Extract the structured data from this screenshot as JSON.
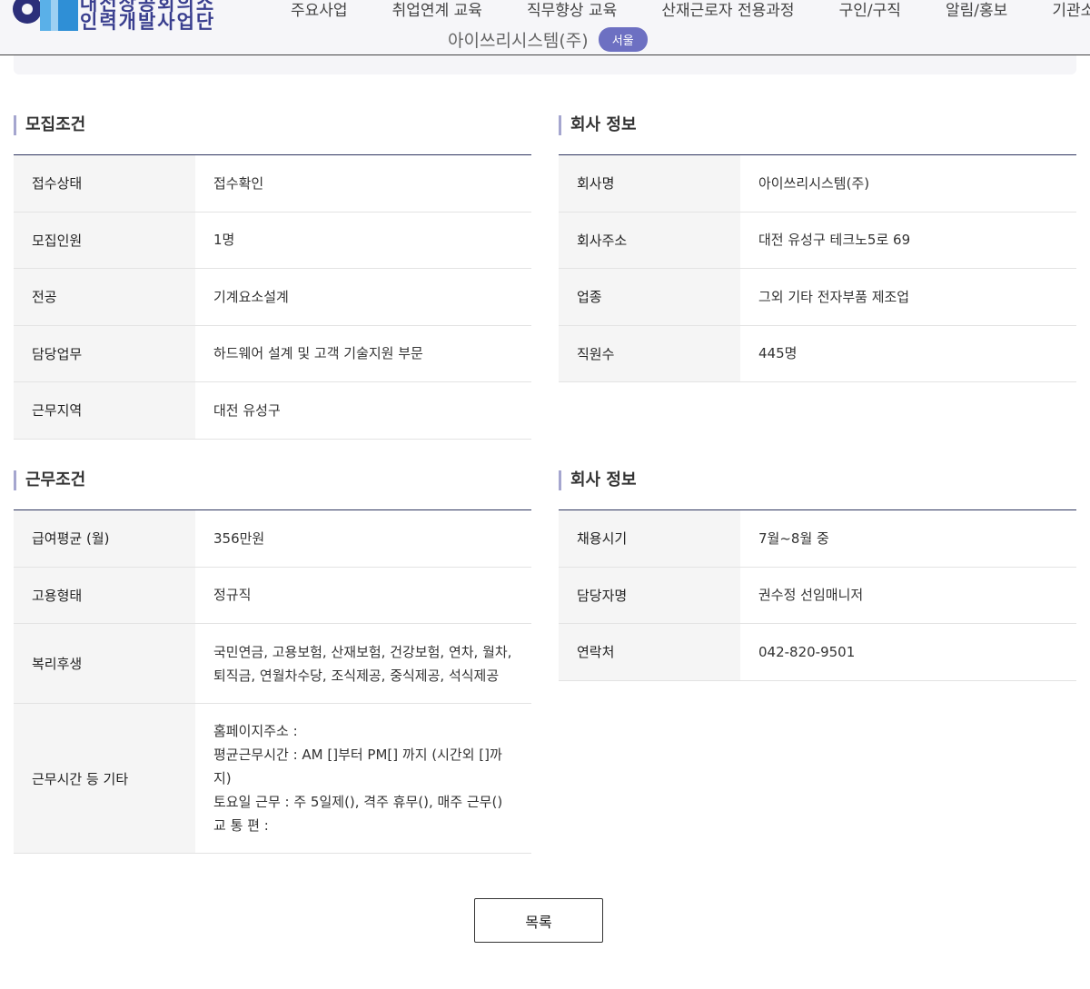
{
  "header": {
    "logo_line1": "대전상공회의소",
    "logo_line2": "인력개발사업단",
    "nav": [
      "주요사업",
      "취업연계 교육",
      "직무향상 교육",
      "산재근로자 전용과정",
      "구인/구직",
      "알림/홍보",
      "기관소개"
    ],
    "company_title": "아이쓰리시스템(주)",
    "region_badge": "서울"
  },
  "recruit": {
    "title": "모집조건",
    "rows": [
      {
        "label": "접수상태",
        "value": "접수확인"
      },
      {
        "label": "모집인원",
        "value": "1명"
      },
      {
        "label": "전공",
        "value": "기계요소설계"
      },
      {
        "label": "담당업무",
        "value": "하드웨어 설계 및 고객 기술지원 부문"
      },
      {
        "label": "근무지역",
        "value": "대전 유성구"
      }
    ]
  },
  "company": {
    "title": "회사 정보",
    "rows": [
      {
        "label": "회사명",
        "value": "아이쓰리시스템(주)"
      },
      {
        "label": "회사주소",
        "value": "대전 유성구 테크노5로 69"
      },
      {
        "label": "업종",
        "value": "그외 기타 전자부품 제조업"
      },
      {
        "label": "직원수",
        "value": "445명"
      }
    ]
  },
  "work": {
    "title": "근무조건",
    "rows": [
      {
        "label": "급여평균 (월)",
        "value": "356만원"
      },
      {
        "label": "고용형태",
        "value": "정규직"
      },
      {
        "label": "복리후생",
        "value": "국민연금, 고용보험, 산재보험, 건강보험, 연차, 월차, 퇴직금, 연월차수당, 조식제공, 중식제공, 석식제공"
      },
      {
        "label": "근무시간 등 기타",
        "lines": [
          "홈페이지주소 :",
          "평균근무시간 : AM []부터 PM[] 까지 (시간외 []까지)",
          "토요일 근무 : 주 5일제(), 격주 휴무(), 매주 근무()",
          "교 통 편 :"
        ]
      }
    ]
  },
  "contact": {
    "title": "회사 정보",
    "rows": [
      {
        "label": "채용시기",
        "value": "7월~8월 중"
      },
      {
        "label": "담당자명",
        "value": "권수정 선임매니저"
      },
      {
        "label": "연락처",
        "value": "042-820-9501"
      }
    ]
  },
  "list_button": "목록"
}
